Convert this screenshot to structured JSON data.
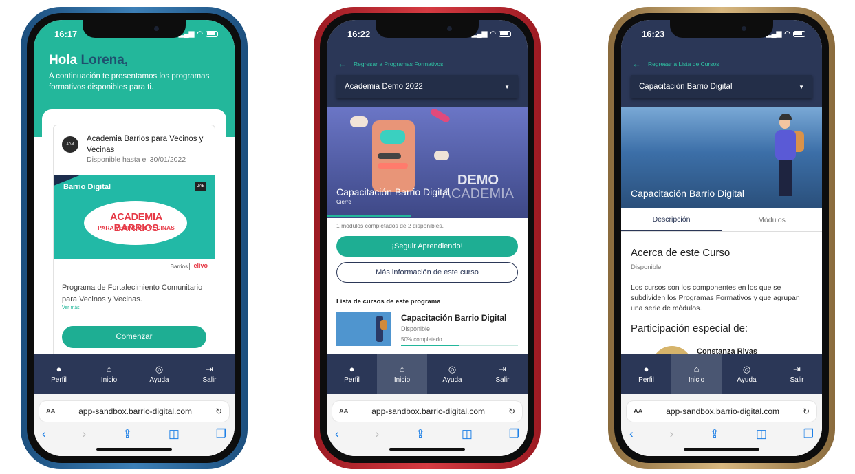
{
  "phones": [
    {
      "time": "16:17",
      "greeting_hola": "Hola",
      "greeting_name": "Lorena,",
      "intro": "A continuación te presentamos los programas formativos disponibles para ti.",
      "program": {
        "logo_text": "JAB",
        "title": "Academia Barrios para Vecinos y Vecinas",
        "availability": "Disponible hasta el 30/01/2022",
        "banner_brand": "Barrio Digital",
        "banner_logo": "JAB",
        "banner_line1": "ACADEMIA BARRIOS",
        "banner_line2": "PARA VECINOS Y VECINAS",
        "partner1": "Barrios",
        "partner2": "elivo",
        "description": "Programa de Fortalecimiento Comunitario para Vecinos y Vecinas.",
        "see_more": "Ver más",
        "cta": "Comenzar"
      },
      "nav": [
        "Perfil",
        "Inicio",
        "Ayuda",
        "Salir"
      ],
      "active_nav": -1,
      "url": "app-sandbox.barrio-digital.com"
    },
    {
      "time": "16:22",
      "back_label": "Regresar a Programas Formativos",
      "select_value": "Academia Demo 2022",
      "hero_title": "Capacitación Barrio Digital",
      "hero_subtitle": "Cierre",
      "hero_demo1": "DEMO",
      "hero_demo2": "ACADEMIA",
      "modules_done": "1 módulos completados de 2 disponibles.",
      "progress_fraction": 0.42,
      "primary_button": "¡Seguir Aprendiendo!",
      "secondary_button": "Más información de este curso",
      "list_heading": "Lista de cursos de este programa",
      "course": {
        "title": "Capacitación Barrio Digital",
        "status": "Disponible",
        "percent_label": "50% completado",
        "percent": 50
      },
      "nav": [
        "Perfil",
        "Inicio",
        "Ayuda",
        "Salir"
      ],
      "active_nav": 1,
      "url": "app-sandbox.barrio-digital.com"
    },
    {
      "time": "16:23",
      "back_label": "Regresar a Lista de Cursos",
      "select_value": "Capacitación Barrio Digital",
      "hero_title": "Capacitación Barrio Digital",
      "tabs": [
        "Descripción",
        "Módulos"
      ],
      "active_tab": 0,
      "about_title": "Acerca de este Curso",
      "about_status": "Disponible",
      "about_text": "Los cursos son los componentes en los que se subdividen los Programas Formativos y que agrupan una serie de módulos.",
      "participation_title": "Participación especial de:",
      "participant_name": "Constanza Rivas",
      "nav": [
        "Perfil",
        "Inicio",
        "Ayuda",
        "Salir"
      ],
      "active_nav": 1,
      "url": "app-sandbox.barrio-digital.com"
    }
  ],
  "colors": {
    "teal": "#23b79b",
    "navy": "#2b3757",
    "frame_blue": "#3c7fb6",
    "frame_red": "#d53b42",
    "frame_gold": "#d7b77f"
  }
}
